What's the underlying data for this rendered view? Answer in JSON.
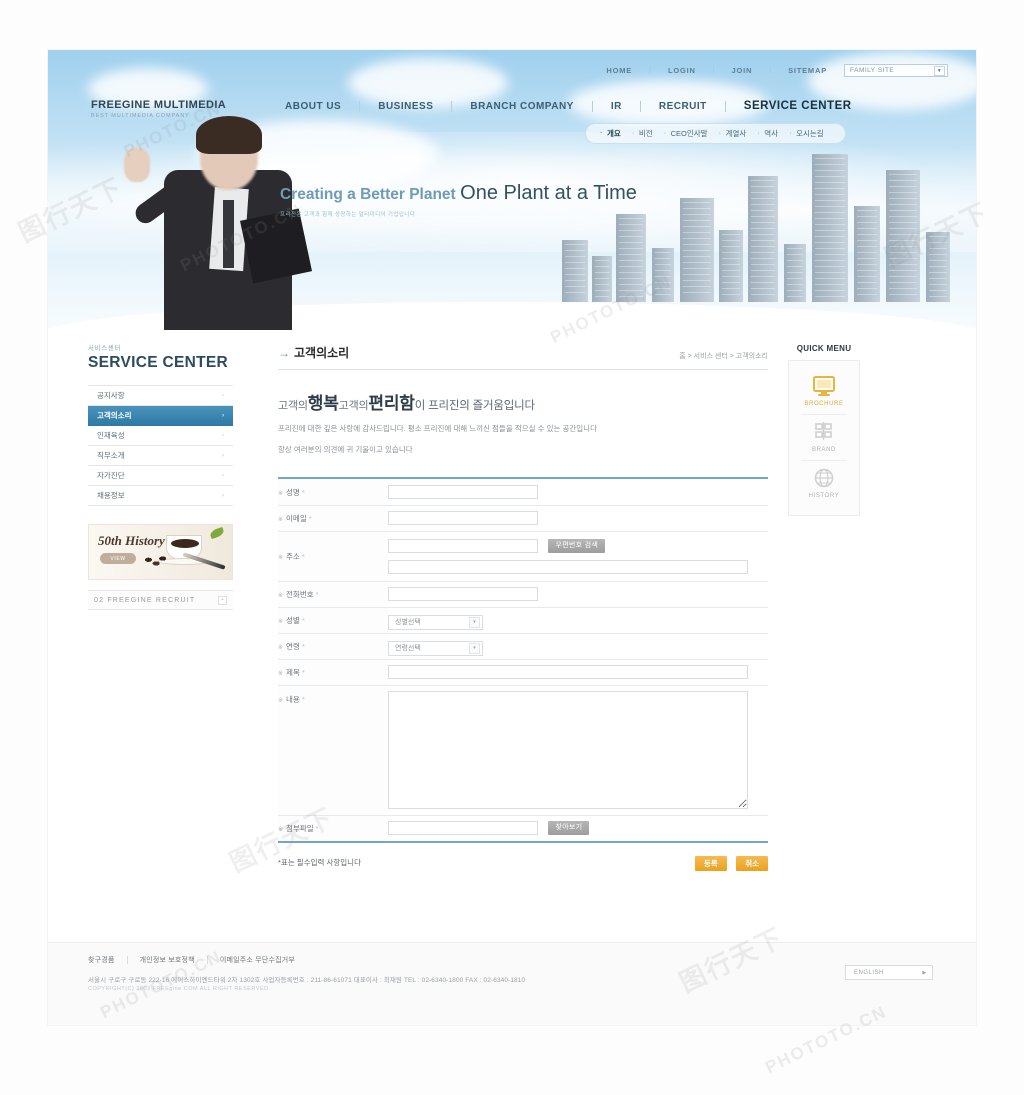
{
  "utility_nav": {
    "links": [
      "HOME",
      "LOGIN",
      "JOIN",
      "SITEMAP"
    ],
    "family_site": {
      "label": "FAMILY SITE",
      "arrow": "▼"
    }
  },
  "logo": {
    "name": "FREEGINE MULTIMEDIA",
    "tagline": "BEST MULTIMEDIA COMPANY"
  },
  "main_nav": {
    "items": [
      {
        "label": "ABOUT US",
        "active": false
      },
      {
        "label": "BUSINESS",
        "active": false
      },
      {
        "label": "BRANCH COMPANY",
        "active": false
      },
      {
        "label": "IR",
        "active": false
      },
      {
        "label": "RECRUIT",
        "active": false
      },
      {
        "label": "SERVICE CENTER",
        "active": true
      }
    ]
  },
  "sub_nav": {
    "items": [
      "개요",
      "비전",
      "CEO인사말",
      "계열사",
      "역사",
      "오시는길"
    ]
  },
  "hero": {
    "tagline_light": "Creating a Better Planet",
    "tagline_bold": "One Plant at a Time",
    "tagline_sub": "프리진은 고객과 함께 성장하는 멀티미디어 기업입니다"
  },
  "sidebar": {
    "small_title": "서비스센터",
    "title": "SERVICE CENTER",
    "items": [
      {
        "label": "공지사항",
        "active": false
      },
      {
        "label": "고객의소리",
        "active": true
      },
      {
        "label": "인재육성",
        "active": false
      },
      {
        "label": "직무소개",
        "active": false
      },
      {
        "label": "자가진단",
        "active": false
      },
      {
        "label": "채용정보",
        "active": false
      }
    ],
    "chevron": "›",
    "banner": {
      "title": "50th History",
      "button": "VIEW"
    },
    "banner2": {
      "title": "02 FREEGINE RECRUIT",
      "arrow": "+"
    }
  },
  "content": {
    "arrow": "→",
    "title": "고객의소리",
    "breadcrumb": "홈 > 서비스 센터 > 고객의소리",
    "headline": {
      "p1": "고객의",
      "b1": "행복",
      "p2": "고객의",
      "b2": "편리함",
      "p3": "이 프리진의 즐거움입니다"
    },
    "desc_line1": "프리진에 대한 깊은 사랑에 감사드립니다. 평소 프리진에 대해 느끼신 점들을 적으실 수 있는 공간입니다",
    "desc_line2": "항상 여러분의 의견에 귀 기울이고 있습니다",
    "form": {
      "rows": [
        {
          "label": "성명",
          "required": "*"
        },
        {
          "label": "이메일",
          "required": "*"
        },
        {
          "label": "주소",
          "required": "*"
        },
        {
          "label": "전화번호",
          "required": "*"
        },
        {
          "label": "성별",
          "required": "*"
        },
        {
          "label": "연령",
          "required": "*"
        },
        {
          "label": "제목",
          "required": "*"
        },
        {
          "label": "내용",
          "required": "*"
        },
        {
          "label": "첨부파일",
          "required": "*"
        }
      ],
      "zipcode_button": "우편번호 검색",
      "file_button": "찾아보기",
      "gender_select": "성별선택",
      "age_select": "연령선택",
      "name_value": "",
      "email_value": "",
      "address_value": "",
      "address2_value": "",
      "phone_value": "",
      "subject_value": "",
      "content_value": "",
      "file_value": "",
      "dot": "※"
    },
    "note": "*표는 필수입력 사항입니다",
    "submit_button": "등록",
    "cancel_button": "취소"
  },
  "quick_menu": {
    "title": "QUICK MENU",
    "items": [
      {
        "label": "BROCHURE",
        "icon": "monitor-icon",
        "active": true
      },
      {
        "label": "BRAND",
        "icon": "grid-icon",
        "active": false
      },
      {
        "label": "HISTORY",
        "icon": "globe-icon",
        "active": false
      }
    ]
  },
  "footer": {
    "links": [
      "찾구경품",
      "개인정보 보호정책",
      "이메일주소 무단수집거부"
    ],
    "address": "서울시 구로구 구로동 222-16 에이스하이엔드타워 2차 1302호  사업자등록번호 : 211-86-61071  대표이사 : 최재원    TEL : 02-6340-1800   FAX : 02-6340-1810",
    "copyright": "COPYRIGHT(C) 2003 FREEgine.COM ALL RIGHT RESERVED.",
    "language": "ENGLISH",
    "language_arrow": "▶"
  },
  "watermarks": [
    "图行天下",
    "PHOTOTO.CN",
    "PHOTOPHTO"
  ],
  "colors": {
    "accent_blue": "#2f7aa6",
    "accent_orange": "#eca01f",
    "rule_blue": "#6fa9c6",
    "sky": "#9fd0ee"
  }
}
